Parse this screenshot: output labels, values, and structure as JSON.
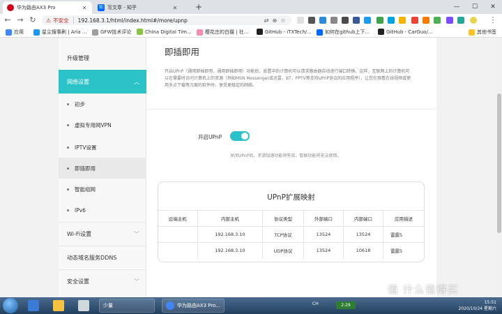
{
  "browser": {
    "tabs": [
      {
        "title": "华为路由AX3 Pro",
        "active": true
      },
      {
        "title": "写文章 - 知乎",
        "active": false
      }
    ],
    "new_tab": "+",
    "window_controls": [
      "—",
      "☐",
      "✕"
    ],
    "insecure_label": "不安全",
    "url": "192.168.3.1/html/index.html#/more/upnp",
    "bookmarks": [
      "应用",
      "星尘搜事刷 | Aria ...",
      "GFW技术评论",
      "China Digital Tim...",
      "樱花庄的白猫 | 社...",
      "GitHub - iTXTech/...",
      "如何在github上下...",
      "GitHub - CarGuo/...",
      "其他书签"
    ]
  },
  "sidebar": {
    "upgrade": "升级管理",
    "network_settings": "网络设置",
    "sub_items": [
      "初步",
      "虚拟专用网VPN",
      "IPTV设置",
      "即插即用",
      "智能组网",
      "IPv6"
    ],
    "groups": [
      "Wi-Fi设置",
      "动态域名服务DDNS",
      "安全设置"
    ]
  },
  "main": {
    "title": "即插即用",
    "description": "开启UPnP（通用即插即用，通用即插即用）功能后，故置中的计算机可以请求路由器自动进行端口转换。这样，互联网上的计算机可以在需要时访问计算机上的资源（例如MSN Messenger或迅雷，BT，PPTV等支持UPnP协议的应用程序），让您在观看在线视频或使用多点下载等方面的软件时，享受更稳定的网络。",
    "toggle_label": "开启UPnP",
    "toggle_on": true,
    "hint": "关闭UPnP后，手游加速功能将失效，智联功能将无法使用。",
    "mapping_title": "UPnP扩展映射",
    "table_headers": [
      "远端主机",
      "内部主机",
      "协议类型",
      "外部端口",
      "内部端口",
      "应用描述"
    ],
    "table_rows": [
      [
        "",
        "192.168.3.10",
        "TCP协议",
        "13524",
        "13524",
        "雷霆5"
      ],
      [
        "",
        "192.168.3.10",
        "UDP协议",
        "13524",
        "10618",
        "雷霆5"
      ]
    ]
  },
  "taskbar": {
    "items": [
      "少量",
      "华为路由AX3 Pro..."
    ],
    "tray_text": "CH",
    "battery": "2:29",
    "clock_time": "15:51",
    "clock_date": "2020/10/24 星期六"
  },
  "watermark": "值 什么值得买",
  "colors": {
    "accent": "#2cc3c8",
    "warning": "#c5221f"
  }
}
